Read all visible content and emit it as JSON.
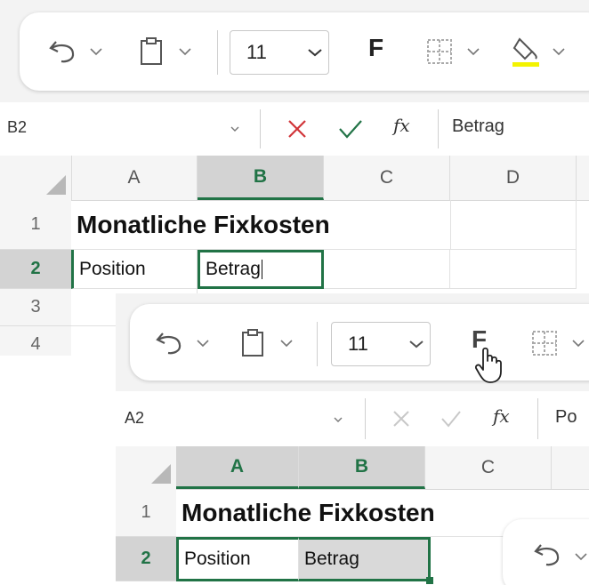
{
  "colors": {
    "accent": "#217346",
    "cancel": "#d13438",
    "highlight": "#f3f300"
  },
  "panel1": {
    "ribbon": {
      "font_size": "11",
      "bold_label": "F"
    },
    "formula_bar": {
      "name_box": "B2",
      "value": "Betrag",
      "fx_label": "fx"
    },
    "columns": [
      "A",
      "B",
      "C",
      "D"
    ],
    "rows": [
      "1",
      "2",
      "3",
      "4"
    ],
    "cells": {
      "A1": "Monatliche Fixkosten",
      "A2": "Position",
      "B2": "Betrag"
    }
  },
  "panel2": {
    "ribbon": {
      "font_size": "11",
      "bold_label": "F"
    },
    "formula_bar": {
      "name_box": "A2",
      "value": "Po",
      "fx_label": "fx"
    },
    "columns": [
      "A",
      "B",
      "C"
    ],
    "rows": [
      "1",
      "2"
    ],
    "cells": {
      "A1": "Monatliche Fixkosten",
      "A2": "Position",
      "B2": "Betrag"
    }
  }
}
